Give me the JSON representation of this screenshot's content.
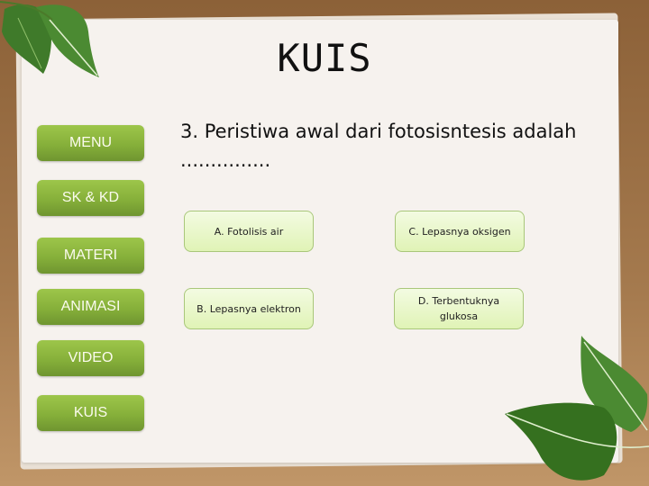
{
  "page": {
    "title": "KUIS"
  },
  "sidebar": {
    "items": [
      {
        "label": "MENU"
      },
      {
        "label": "SK & KD"
      },
      {
        "label": "MATERI"
      },
      {
        "label": "ANIMASI"
      },
      {
        "label": "VIDEO"
      },
      {
        "label": "KUIS"
      }
    ]
  },
  "quiz": {
    "question": "3. Peristiwa awal dari fotosisntesis adalah ...............",
    "answers": [
      {
        "label": "A. Fotolisis air"
      },
      {
        "label": "B. Lepasnya elektron"
      },
      {
        "label": "C. Lepasnya oksigen"
      },
      {
        "label": "D. Terbentuknya glukosa"
      }
    ]
  },
  "colors": {
    "frame": "#8c6138",
    "paper": "#f6f2ee",
    "nav_button": "#86b03a",
    "answer_fill": "#e8f6c8",
    "leaf": "#3e7a28"
  }
}
